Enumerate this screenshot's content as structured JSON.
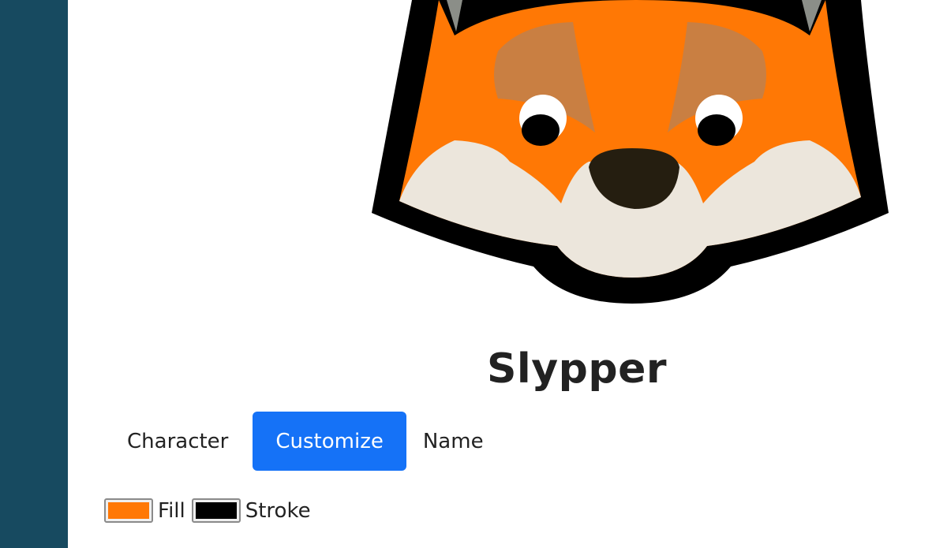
{
  "character": {
    "name": "Slypper"
  },
  "tabs": [
    {
      "label": "Character",
      "active": false
    },
    {
      "label": "Customize",
      "active": true
    },
    {
      "label": "Name",
      "active": false
    }
  ],
  "colors": {
    "fill_label": "Fill",
    "fill_value": "#ff7805",
    "stroke_label": "Stroke",
    "stroke_value": "#000000"
  },
  "theme": {
    "sidebar": "#174a60",
    "accent": "#1572f7"
  }
}
